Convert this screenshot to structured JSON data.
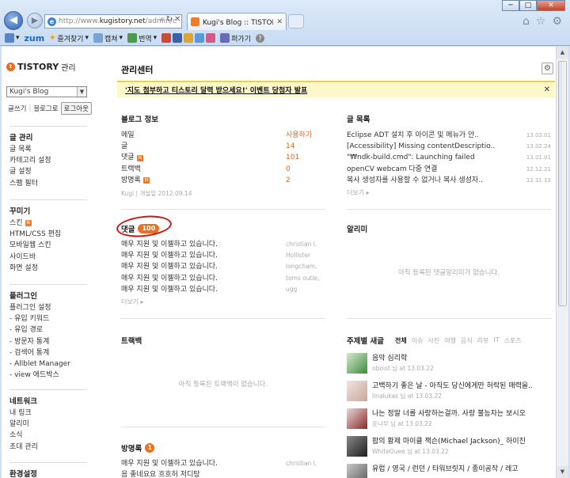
{
  "browser": {
    "window_buttons": [
      "─",
      "□",
      "✕"
    ],
    "url_prefix": "http://www.",
    "url_domain": "kugistory.net",
    "url_path": "/admin/c",
    "tab_title": "Kugi's Blog :: TISTORY 센터",
    "toolbar": {
      "zum": "zum",
      "favorites": "즐겨찾기",
      "capture": "캡쳐",
      "translate": "번역",
      "tool": "퍼가기"
    }
  },
  "sidebar": {
    "logo_text": "TISTORY",
    "logo_sub": "관리",
    "blog_select": "Kugi's Blog",
    "links": [
      "글쓰기",
      "블로그로",
      "로그아웃"
    ],
    "sections": [
      {
        "title": "글 관리",
        "items": [
          {
            "label": "글 목록"
          },
          {
            "label": "카테고리 설정"
          },
          {
            "label": "글 설정"
          },
          {
            "label": "스팸 필터"
          }
        ]
      },
      {
        "title": "꾸미기",
        "items": [
          {
            "label": "스킨",
            "badge": "N"
          },
          {
            "label": "HTML/CSS 편집"
          },
          {
            "label": "모바일웹 스킨"
          },
          {
            "label": "사이드바"
          },
          {
            "label": "화면 설정"
          }
        ]
      },
      {
        "title": "플러그인",
        "items": [
          {
            "label": "플러그인 설정"
          },
          {
            "label": "- 유입 키워드"
          },
          {
            "label": "- 유입 경로"
          },
          {
            "label": "- 방문자 통계"
          },
          {
            "label": "- 검색어 통계"
          },
          {
            "label": "- Allblet Manager"
          },
          {
            "label": "- view 애드박스"
          }
        ]
      },
      {
        "title": "네트워크",
        "items": [
          {
            "label": "내 링크"
          },
          {
            "label": "알리미"
          },
          {
            "label": "소식"
          },
          {
            "label": "초대 관리"
          }
        ]
      },
      {
        "title": "환경설정",
        "items": []
      }
    ]
  },
  "main": {
    "title": "관리센터",
    "banner": "'지도 첨부하고 티스토리 달력 받으세요!' 이벤트 당첨자 발표",
    "blog_info": {
      "title": "블로그 정보",
      "rows": [
        {
          "label": "메일",
          "value": "사용하기"
        },
        {
          "label": "글",
          "value": "14"
        },
        {
          "label": "댓글",
          "value": "101",
          "badge": "N"
        },
        {
          "label": "트랙백",
          "value": "0"
        },
        {
          "label": "방명록",
          "value": "2",
          "badge": "N"
        }
      ],
      "meta_author": "Kugi",
      "meta_opened": "개설일 2012.09.14"
    },
    "posts": {
      "title": "글 목록",
      "rows": [
        {
          "title": "Eclipse ADT 설치 후 아이콘 및 메뉴가 안..",
          "date": "13.03.01"
        },
        {
          "title": "[Accessibility] Missing contentDescriptio..",
          "date": "13.02.24"
        },
        {
          "title": "\"₩ndk-build.cmd\": Launching failed",
          "date": "13.01.01"
        },
        {
          "title": "openCV webcam 다중 연결",
          "date": "12.12.21"
        },
        {
          "title": "복사 생성자를 사용할 수 없거나 복사 생성자..",
          "date": "12.11.13"
        }
      ],
      "more": "더보기 ▸"
    },
    "comments": {
      "title": "댓글",
      "count": "100",
      "rows": [
        {
          "text": "매우 지원 및 이젤하고 있습니다.",
          "author": "christian l,"
        },
        {
          "text": "매우 지원 및 이젤하고 있습니다.",
          "author": "Hollister"
        },
        {
          "text": "매우 지원 및 이젤하고 있습니다.",
          "author": "longcham,"
        },
        {
          "text": "매우 지원 및 이젤하고 있습니다.",
          "author": "toms outle,"
        },
        {
          "text": "매우 지원 및 이젤하고 있습니다.",
          "author": "ugg"
        }
      ],
      "more": "더보기 ▸"
    },
    "notifier": {
      "title": "알리미",
      "empty": "아직 등록된 댓글알리미가 없습니다."
    },
    "trackback": {
      "title": "트랙백",
      "empty": "아직 등록된 트랙백이 없습니다."
    },
    "topics": {
      "title": "주제별 새글",
      "tabs": [
        "전체",
        "이슈",
        "사진",
        "여행",
        "음식",
        "리뷰",
        "IT",
        "스포츠"
      ],
      "items": [
        {
          "title": "음악 심리학",
          "sub": "oboist 님 at 13.03.22",
          "color": "#3c8a3c"
        },
        {
          "title": "고백하기 좋은 날 - 아직도 당신에게만 허락된 매력을..",
          "sub": "linalukas 님 at 13.03.22",
          "color": "#c9a79a"
        },
        {
          "title": "나는 정말 너를 사랑하는걸까. 사랑 불능자는 보시오",
          "sub": "윤니무 님 at 13.03.22",
          "color": "#8a2a2a"
        },
        {
          "title": "팝의 황제 마이클 잭슨(Michael Jackson)_ 하이진",
          "sub": "WhiteOuee 님 at 13.03.22",
          "color": "#2a2a2a"
        },
        {
          "title": "유럽 / 영국 / 런던 / 타워브릿지 / 종이공작 / 레고",
          "sub": "",
          "color": "#6a6a6a"
        }
      ]
    },
    "guestbook": {
      "title": "방명록",
      "count": "1",
      "rows": [
        {
          "text": "매우 지원 및 이젤하고 있습니다.",
          "author": "christian l,"
        },
        {
          "text": "음 좋네요요 흐흐허 저디탕",
          "author": ""
        }
      ]
    }
  }
}
